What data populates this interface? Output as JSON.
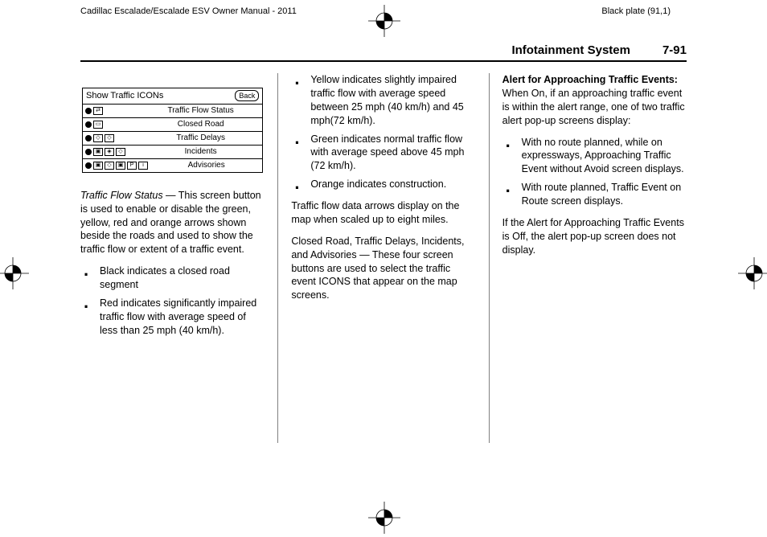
{
  "top": {
    "left": "Cadillac Escalade/Escalade ESV Owner Manual - 2011",
    "right": "Black plate (91,1)"
  },
  "header": {
    "section": "Infotainment System",
    "page": "7-91"
  },
  "figure": {
    "title": "Show Traffic ICONs",
    "back": "Back",
    "rows": [
      {
        "label": "Traffic Flow Status"
      },
      {
        "label": "Closed Road"
      },
      {
        "label": "Traffic Delays"
      },
      {
        "label": "Incidents"
      },
      {
        "label": "Advisories"
      }
    ]
  },
  "col1": {
    "lead_em": "Traffic Flow Status",
    "lead_rest": " — This screen button is used to enable or disable the green, yellow, red and orange arrows shown beside the roads and used to show the traffic flow or extent of a traffic event.",
    "bullets": [
      "Black indicates a closed road segment",
      "Red indicates significantly impaired traffic flow with average speed of less than 25 mph (40 km/h)."
    ]
  },
  "col2": {
    "bullets": [
      "Yellow indicates slightly impaired traffic flow with average speed between 25 mph (40 km/h) and 45 mph(72 km/h).",
      "Green indicates normal traffic flow with average speed above 45 mph (72 km/h).",
      "Orange indicates construction."
    ],
    "p1": "Traffic flow data arrows display on the map when scaled up to eight miles.",
    "p2": "Closed Road, Traffic Delays, Incidents, and Advisories — These four screen buttons are used to select the traffic event ICONS that appear on the map screens."
  },
  "col3": {
    "lead_bold": "Alert for Approaching Traffic Events:",
    "lead_rest": "  When On, if an approaching traffic event is within the alert range, one of two traffic alert pop-up screens display:",
    "bullets": [
      "With no route planned, while on expressways, Approaching Traffic Event without Avoid screen displays.",
      "With route planned, Traffic Event on Route screen displays."
    ],
    "p1": "If the Alert for Approaching Traffic Events is Off, the alert pop-up screen does not display."
  }
}
